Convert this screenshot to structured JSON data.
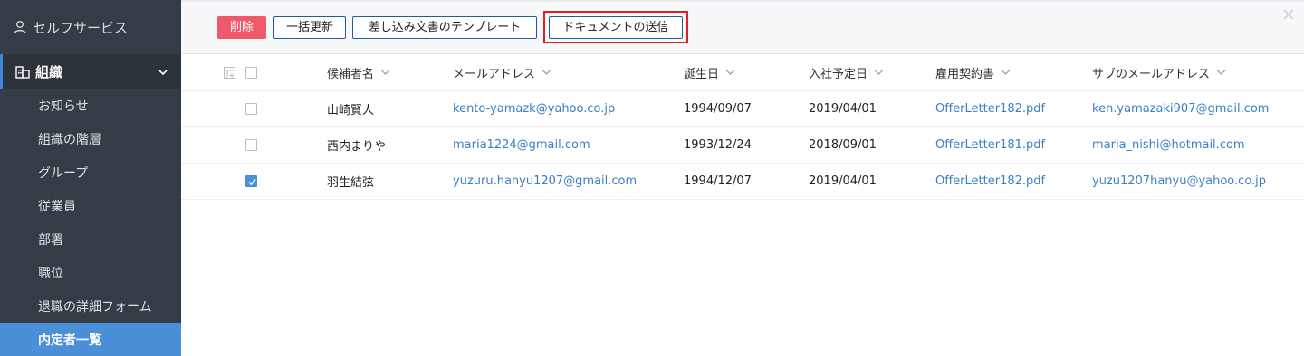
{
  "sidebar": {
    "self_service": "セルフサービス",
    "org_header": "組織",
    "items": [
      {
        "label": "お知らせ"
      },
      {
        "label": "組織の階層"
      },
      {
        "label": "グループ"
      },
      {
        "label": "従業員"
      },
      {
        "label": "部署"
      },
      {
        "label": "職位"
      },
      {
        "label": "退職の詳細フォーム"
      },
      {
        "label": "内定者一覧"
      }
    ],
    "active_item": "内定者一覧"
  },
  "toolbar": {
    "delete_label": "削除",
    "bulk_update_label": "一括更新",
    "template_label": "差し込み文書のテンプレート",
    "send_documents_label": "ドキュメントの送信"
  },
  "table": {
    "columns": [
      "候補者名",
      "メールアドレス",
      "誕生日",
      "入社予定日",
      "雇用契約書",
      "サブのメールアドレス"
    ],
    "rows": [
      {
        "checked": false,
        "name": "山崎賢人",
        "email": "kento-yamazk@yahoo.co.jp",
        "birthday": "1994/09/07",
        "join_date": "2019/04/01",
        "contract": "OfferLetter182.pdf",
        "sub_email": "ken.yamazaki907@gmail.com"
      },
      {
        "checked": false,
        "name": "西内まりや",
        "email": "maria1224@gmail.com",
        "birthday": "1993/12/24",
        "join_date": "2018/09/01",
        "contract": "OfferLetter181.pdf",
        "sub_email": "maria_nishi@hotmail.com"
      },
      {
        "checked": true,
        "name": "羽生結弦",
        "email": "yuzuru.hanyu1207@gmail.com",
        "birthday": "1994/12/07",
        "join_date": "2019/04/01",
        "contract": "OfferLetter182.pdf",
        "sub_email": "yuzu1207hanyu@yahoo.co.jp"
      }
    ]
  },
  "colors": {
    "sidebar_bg": "#343d46",
    "active_item_bg": "#4a90d9",
    "delete_button": "#ef5a6b",
    "link": "#3a7fc6",
    "highlight_box": "#e02020"
  },
  "icons": [
    "user-icon",
    "organization-icon",
    "chevron-down-icon",
    "column-settings-icon",
    "sort-chevron-icon",
    "close-icon",
    "checkmark-icon"
  ]
}
